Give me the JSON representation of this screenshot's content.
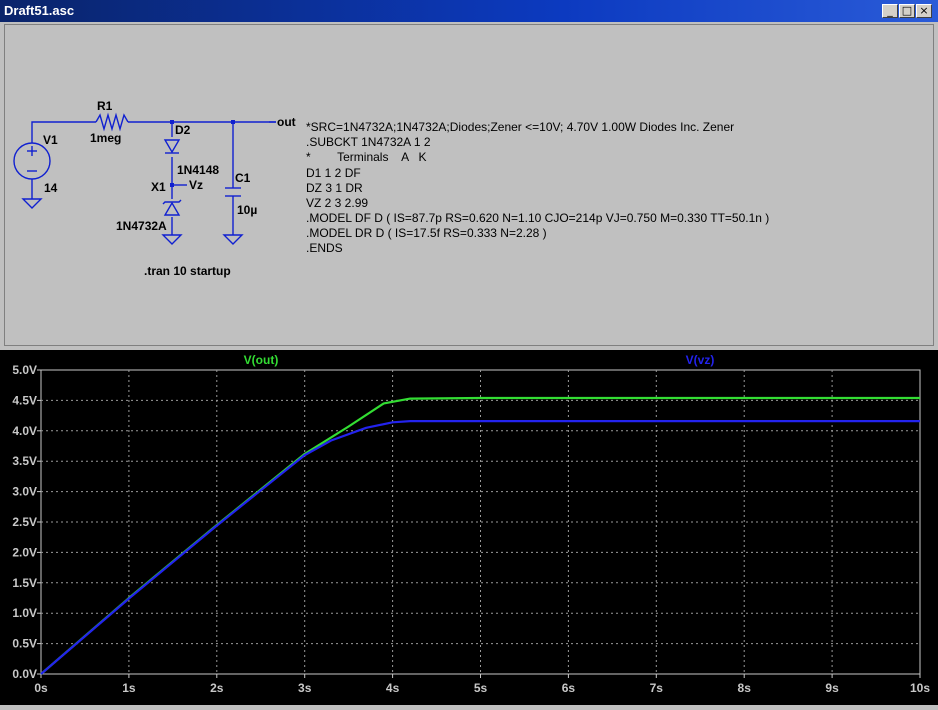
{
  "window": {
    "title": "Draft51.asc"
  },
  "window_buttons": [
    "minimize-icon",
    "maximize-icon",
    "close-icon"
  ],
  "schematic": {
    "labels": {
      "r1": "R1",
      "r1_value": "1meg",
      "v1": "V1",
      "v1_value": "14",
      "d2": "D2",
      "d2_model": "1N4148",
      "x1": "X1",
      "x1_model": "1N4732A",
      "c1": "C1",
      "c1_value": "10µ",
      "net_out": "out",
      "net_vz": "Vz",
      "directive": ".tran 10 startup"
    },
    "spice_lines": [
      "*SRC=1N4732A;1N4732A;Diodes;Zener <=10V; 4.70V  1.00W   Diodes Inc. Zener",
      ".SUBCKT 1N4732A  1 2",
      "*        Terminals    A   K",
      "D1 1 2 DF",
      "DZ 3 1 DR",
      "VZ 2 3 2.99",
      ".MODEL DF D ( IS=87.7p RS=0.620 N=1.10 CJO=214p VJ=0.750 M=0.330 TT=50.1n )",
      ".MODEL DR D ( IS=17.5f RS=0.333 N=2.28 )",
      ".ENDS"
    ]
  },
  "colors": {
    "out": "#33dd33",
    "vz": "#2323ee",
    "grid": "#9a9a9a",
    "axis_text": "#c8c8c8"
  },
  "chart_data": {
    "type": "line",
    "xlim": [
      0,
      10
    ],
    "ylim": [
      0,
      5
    ],
    "x_ticks": [
      "0s",
      "1s",
      "2s",
      "3s",
      "4s",
      "5s",
      "6s",
      "7s",
      "8s",
      "9s",
      "10s"
    ],
    "y_ticks": [
      "0.0V",
      "0.5V",
      "1.0V",
      "1.5V",
      "2.0V",
      "2.5V",
      "3.0V",
      "3.5V",
      "4.0V",
      "4.5V",
      "5.0V"
    ],
    "grid": true,
    "legend_position": "top",
    "series": [
      {
        "name": "V(out)",
        "x": [
          0,
          1,
          2,
          3,
          3.5,
          3.9,
          4.2,
          5,
          10
        ],
        "y": [
          0,
          1.25,
          2.45,
          3.62,
          4.07,
          4.45,
          4.53,
          4.54,
          4.54
        ]
      },
      {
        "name": "V(vz)",
        "x": [
          0,
          1,
          2,
          3,
          3.3,
          3.7,
          4,
          4.2,
          5,
          10
        ],
        "y": [
          0,
          1.24,
          2.44,
          3.6,
          3.84,
          4.05,
          4.14,
          4.16,
          4.16,
          4.16
        ]
      }
    ]
  }
}
